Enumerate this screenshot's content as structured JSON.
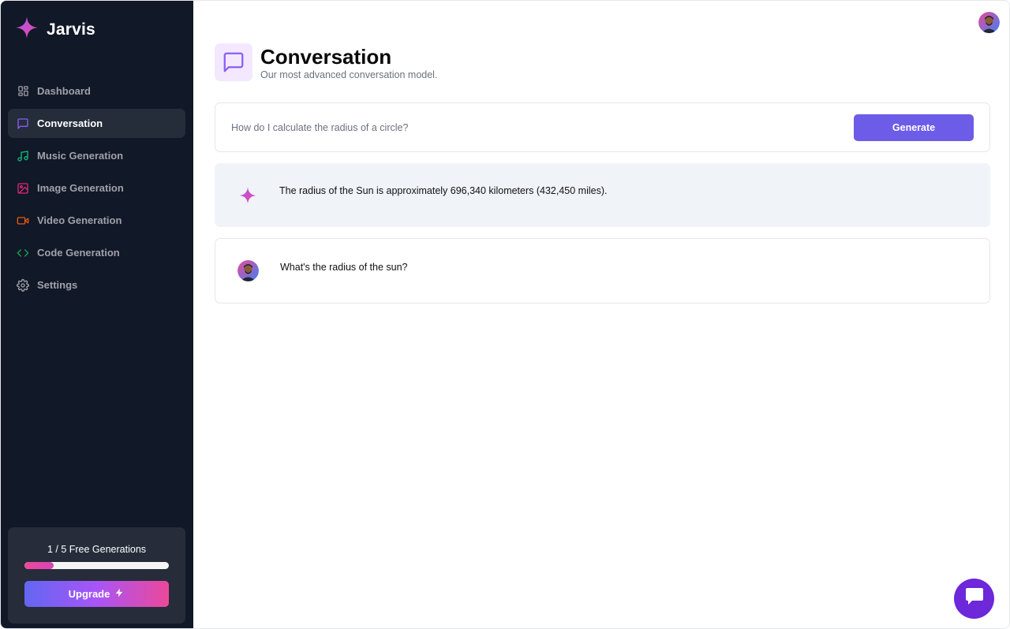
{
  "app": {
    "title": "Jarvis"
  },
  "sidebar": {
    "items": [
      {
        "label": "Dashboard",
        "icon": "dashboard-icon",
        "color": "#a1a1aa",
        "active": false
      },
      {
        "label": "Conversation",
        "icon": "message-square-icon",
        "color": "#8b5cf6",
        "active": true
      },
      {
        "label": "Music Generation",
        "icon": "music-icon",
        "color": "#10b981",
        "active": false
      },
      {
        "label": "Image Generation",
        "icon": "image-icon",
        "color": "#db2777",
        "active": false
      },
      {
        "label": "Video Generation",
        "icon": "video-icon",
        "color": "#ea580c",
        "active": false
      },
      {
        "label": "Code Generation",
        "icon": "code-icon",
        "color": "#16a34a",
        "active": false
      },
      {
        "label": "Settings",
        "icon": "gear-icon",
        "color": "#a1a1aa",
        "active": false
      }
    ],
    "usage": {
      "text": "1 / 5 Free Generations",
      "used": 1,
      "limit": 5,
      "fraction": 0.2
    },
    "upgrade_label": "Upgrade"
  },
  "header": {
    "title": "Conversation",
    "subtitle": "Our most advanced conversation model."
  },
  "prompt": {
    "value": "",
    "placeholder": "How do I calculate the radius of a circle?",
    "button_label": "Generate"
  },
  "messages": [
    {
      "role": "bot",
      "text": "The radius of the Sun is approximately 696,340 kilometers (432,450 miles)."
    },
    {
      "role": "user",
      "text": "What's the radius of the sun?"
    }
  ],
  "colors": {
    "accent": "#6c5ce7",
    "sidebar_bg": "#111827",
    "brand_gradient_start": "#ec4899",
    "brand_gradient_end": "#a855f7"
  }
}
